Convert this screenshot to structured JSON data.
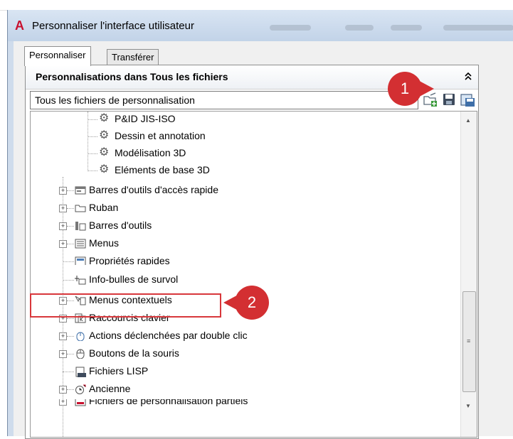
{
  "window": {
    "app_logo": "A",
    "title": "Personnaliser l'interface utilisateur"
  },
  "tabs": [
    {
      "label": "Personnaliser",
      "active": true
    },
    {
      "label": "Transférer",
      "active": false
    }
  ],
  "panel": {
    "header": "Personnalisations dans Tous les fichiers",
    "collapse_icon": "double-chevron-up-icon",
    "combo_value": "Tous les fichiers de personnalisation",
    "toolbar_icons": [
      "open-file-icon",
      "save-icon",
      "save-as-icon"
    ]
  },
  "tree": [
    {
      "label": "P&ID JIS-ISO",
      "icon": "gear-icon",
      "level": 3
    },
    {
      "label": "Dessin et annotation",
      "icon": "gear-icon",
      "level": 3
    },
    {
      "label": "Modélisation 3D",
      "icon": "gear-icon",
      "level": 3
    },
    {
      "label": "Eléments de base 3D",
      "icon": "gear-icon",
      "level": 3
    },
    {
      "label": "Barres d'outils d'accès rapide",
      "icon": "quick-access-toolbar-icon",
      "level": 1,
      "expandable": true
    },
    {
      "label": "Ruban",
      "icon": "ribbon-icon",
      "level": 1,
      "expandable": true
    },
    {
      "label": "Barres d'outils",
      "icon": "toolbar-icon",
      "level": 1,
      "expandable": true
    },
    {
      "label": "Menus",
      "icon": "menu-icon",
      "level": 1,
      "expandable": true
    },
    {
      "label": "Propriétés rapides",
      "icon": "quick-properties-icon",
      "level": 1,
      "expandable": false
    },
    {
      "label": "Info-bulles de survol",
      "icon": "rollover-tooltip-icon",
      "level": 1,
      "expandable": false
    },
    {
      "label": "Menus contextuels",
      "icon": "shortcut-menu-icon",
      "level": 1,
      "expandable": true
    },
    {
      "label": "Raccourcis clavier",
      "icon": "keyboard-shortcut-icon",
      "level": 1,
      "expandable": true
    },
    {
      "label": "Actions déclenchées par double clic",
      "icon": "double-click-icon",
      "level": 1,
      "expandable": true
    },
    {
      "label": "Boutons de la souris",
      "icon": "mouse-icon",
      "level": 1,
      "expandable": true
    },
    {
      "label": "Fichiers LISP",
      "icon": "lisp-file-icon",
      "level": 1,
      "expandable": false
    },
    {
      "label": "Ancienne",
      "icon": "legacy-icon",
      "level": 1,
      "expandable": true
    },
    {
      "label": "Fichiers de personnalisation partiels",
      "icon": "partial-cui-icon",
      "level": 1,
      "expandable": true
    }
  ],
  "callouts": [
    {
      "number": "1"
    },
    {
      "number": "2"
    }
  ],
  "colors": {
    "callout_red": "#d32f32",
    "highlight_red": "#d8373b"
  }
}
